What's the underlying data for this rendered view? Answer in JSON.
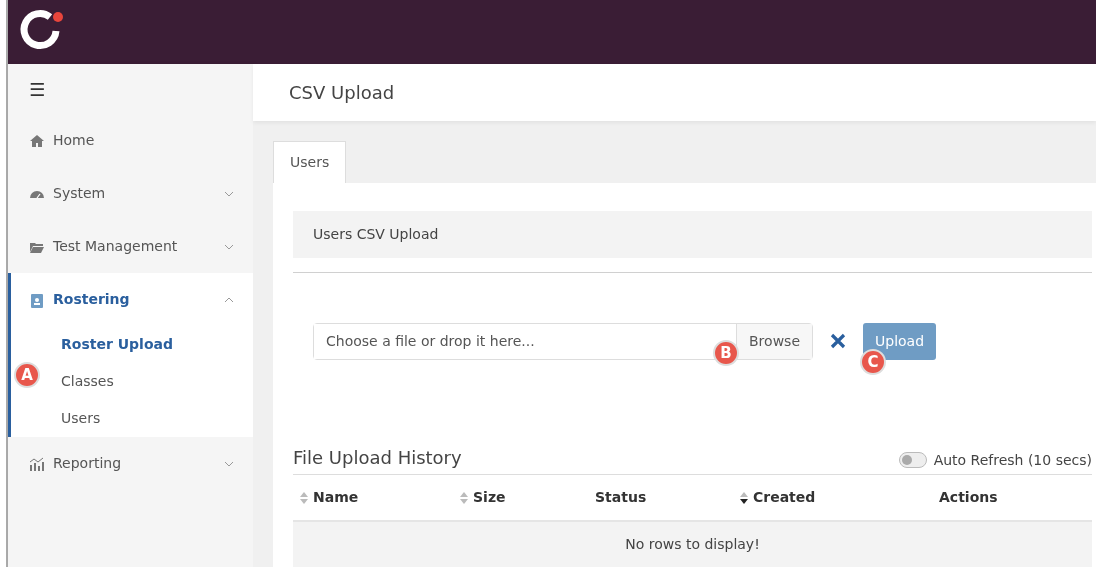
{
  "sidebar": {
    "toggle": "☰",
    "items": [
      {
        "label": "Home",
        "kind": "home",
        "expandable": false,
        "expanded": false,
        "selected": false
      },
      {
        "label": "System",
        "kind": "gauge",
        "expandable": true,
        "expanded": false,
        "selected": false
      },
      {
        "label": "Test Management",
        "kind": "folder",
        "expandable": true,
        "expanded": false,
        "selected": false
      },
      {
        "label": "Rostering",
        "kind": "badge",
        "expandable": true,
        "expanded": true,
        "selected": true,
        "children": [
          {
            "label": "Roster Upload",
            "selected": true
          },
          {
            "label": "Classes",
            "selected": false
          },
          {
            "label": "Users",
            "selected": false
          }
        ]
      },
      {
        "label": "Reporting",
        "kind": "chart",
        "expandable": true,
        "expanded": false,
        "selected": false
      }
    ]
  },
  "page_title": "CSV Upload",
  "tabs": [
    {
      "label": "Users",
      "selected": true
    }
  ],
  "section_title": "Users CSV Upload",
  "file_input": {
    "placeholder": "Choose a file or drop it here...",
    "browse": "Browse"
  },
  "upload_button": {
    "label": "Upload",
    "disabled": true
  },
  "history": {
    "title": "File Upload History",
    "auto_refresh": {
      "label": "Auto Refresh (10 secs)",
      "on": false
    },
    "columns": [
      {
        "label": "Name",
        "sortable": true
      },
      {
        "label": "Size",
        "sortable": true
      },
      {
        "label": "Status",
        "sortable": false
      },
      {
        "label": "Created",
        "sortable": true,
        "sort_descending": true
      },
      {
        "label": "Actions",
        "sortable": false
      }
    ],
    "empty_message": "No rows to display!"
  },
  "callouts": [
    {
      "label": "A"
    },
    {
      "label": "B"
    },
    {
      "label": "C"
    }
  ]
}
